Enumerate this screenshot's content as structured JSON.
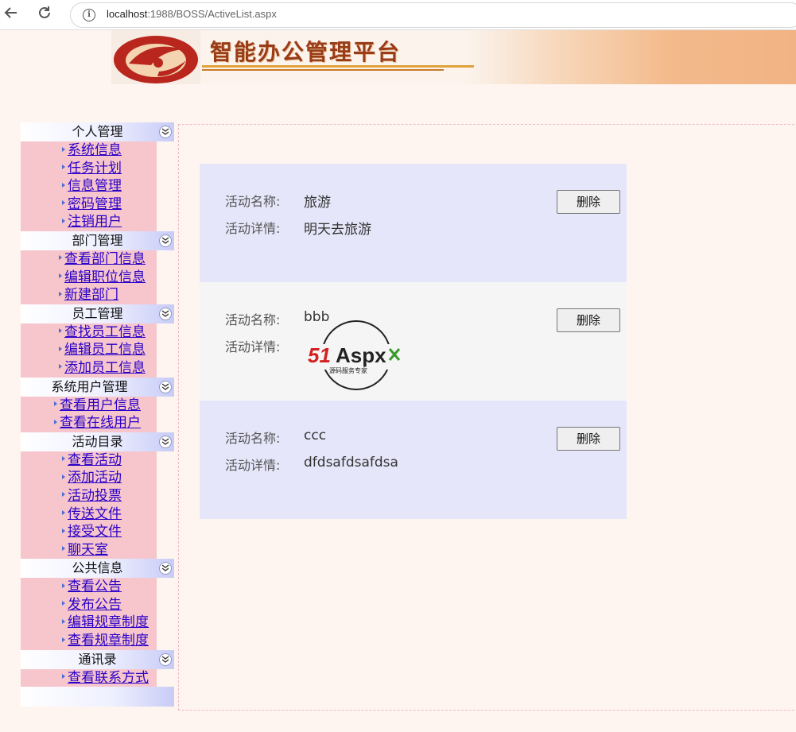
{
  "browser": {
    "url_host": "localhost",
    "url_rest": ":1988/BOSS/ActiveList.aspx",
    "back_icon": "back-arrow-icon",
    "reload_icon": "reload-icon",
    "info_icon": "info-icon"
  },
  "banner": {
    "title": "智能办公管理平台"
  },
  "sidebar": {
    "sections": [
      {
        "title": "个人管理",
        "items": [
          "系统信息",
          "任务计划",
          "信息管理",
          "密码管理",
          "注销用户"
        ]
      },
      {
        "title": "部门管理",
        "items": [
          "查看部门信息",
          "编辑职位信息",
          "新建部门"
        ]
      },
      {
        "title": "员工管理",
        "items": [
          "查找员工信息",
          "编辑员工信息",
          "添加员工信息"
        ]
      },
      {
        "title": "系统用户管理",
        "items": [
          "查看用户信息",
          "查看在线用户"
        ]
      },
      {
        "title": "活动目录",
        "items": [
          "查看活动",
          "添加活动",
          "活动投票",
          "传送文件",
          "接受文件",
          "聊天室"
        ]
      },
      {
        "title": "公共信息",
        "items": [
          "查看公告",
          "发布公告",
          "编辑规章制度",
          "查看规章制度"
        ]
      },
      {
        "title": "通讯录",
        "items": [
          "查看联系方式"
        ]
      }
    ]
  },
  "activities": {
    "name_label": "活动名称:",
    "detail_label": "活动详情:",
    "delete_label": "删除",
    "list": [
      {
        "name": "旅游",
        "detail": "明天去旅游"
      },
      {
        "name": "bbb",
        "detail": "",
        "detail_image_text": "51Aspx",
        "detail_image_subtext": "源码服务专家"
      },
      {
        "name": "ccc",
        "detail": "dfdsafdsafdsa"
      }
    ]
  },
  "colors": {
    "page_bg": "#fff5f0",
    "menu_items_bg": "#f6c6cc",
    "link": "#2a00c8",
    "activity_bg_a": "#e6e6fa",
    "activity_bg_b": "#f5f5f5",
    "banner_title": "#9a3c17"
  }
}
